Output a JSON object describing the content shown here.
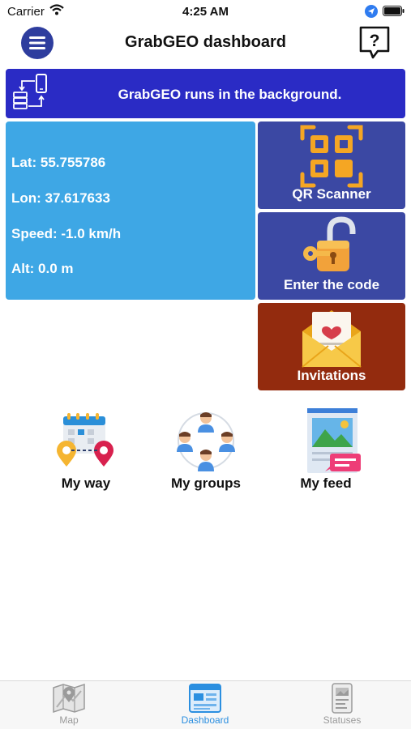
{
  "status_bar": {
    "carrier": "Carrier",
    "time": "4:25 AM"
  },
  "nav": {
    "title": "GrabGEO dashboard"
  },
  "banner": {
    "text": "GrabGEO runs in the background."
  },
  "location": {
    "lat": "Lat: 55.755786",
    "lon": "Lon: 37.617633",
    "speed": "Speed: -1.0 km/h",
    "alt": "Alt: 0.0 m"
  },
  "tiles": {
    "qr_label": "QR Scanner",
    "code_label": "Enter the code",
    "invitations_label": "Invitations"
  },
  "features": {
    "my_way": "My way",
    "my_groups": "My groups",
    "my_feed": "My feed"
  },
  "tabs": [
    {
      "label": "Map",
      "icon": "map-icon"
    },
    {
      "label": "Dashboard",
      "icon": "dashboard-icon",
      "active": true
    },
    {
      "label": "Statuses",
      "icon": "statuses-icon"
    }
  ],
  "colors": {
    "banner": "#2a2bc5",
    "location_card": "#3ea7e5",
    "tile_blue": "#3b48a3",
    "tile_invitations": "#932b0e",
    "menu_button": "#2e3d9e",
    "tab_active": "#2b8fe0"
  }
}
